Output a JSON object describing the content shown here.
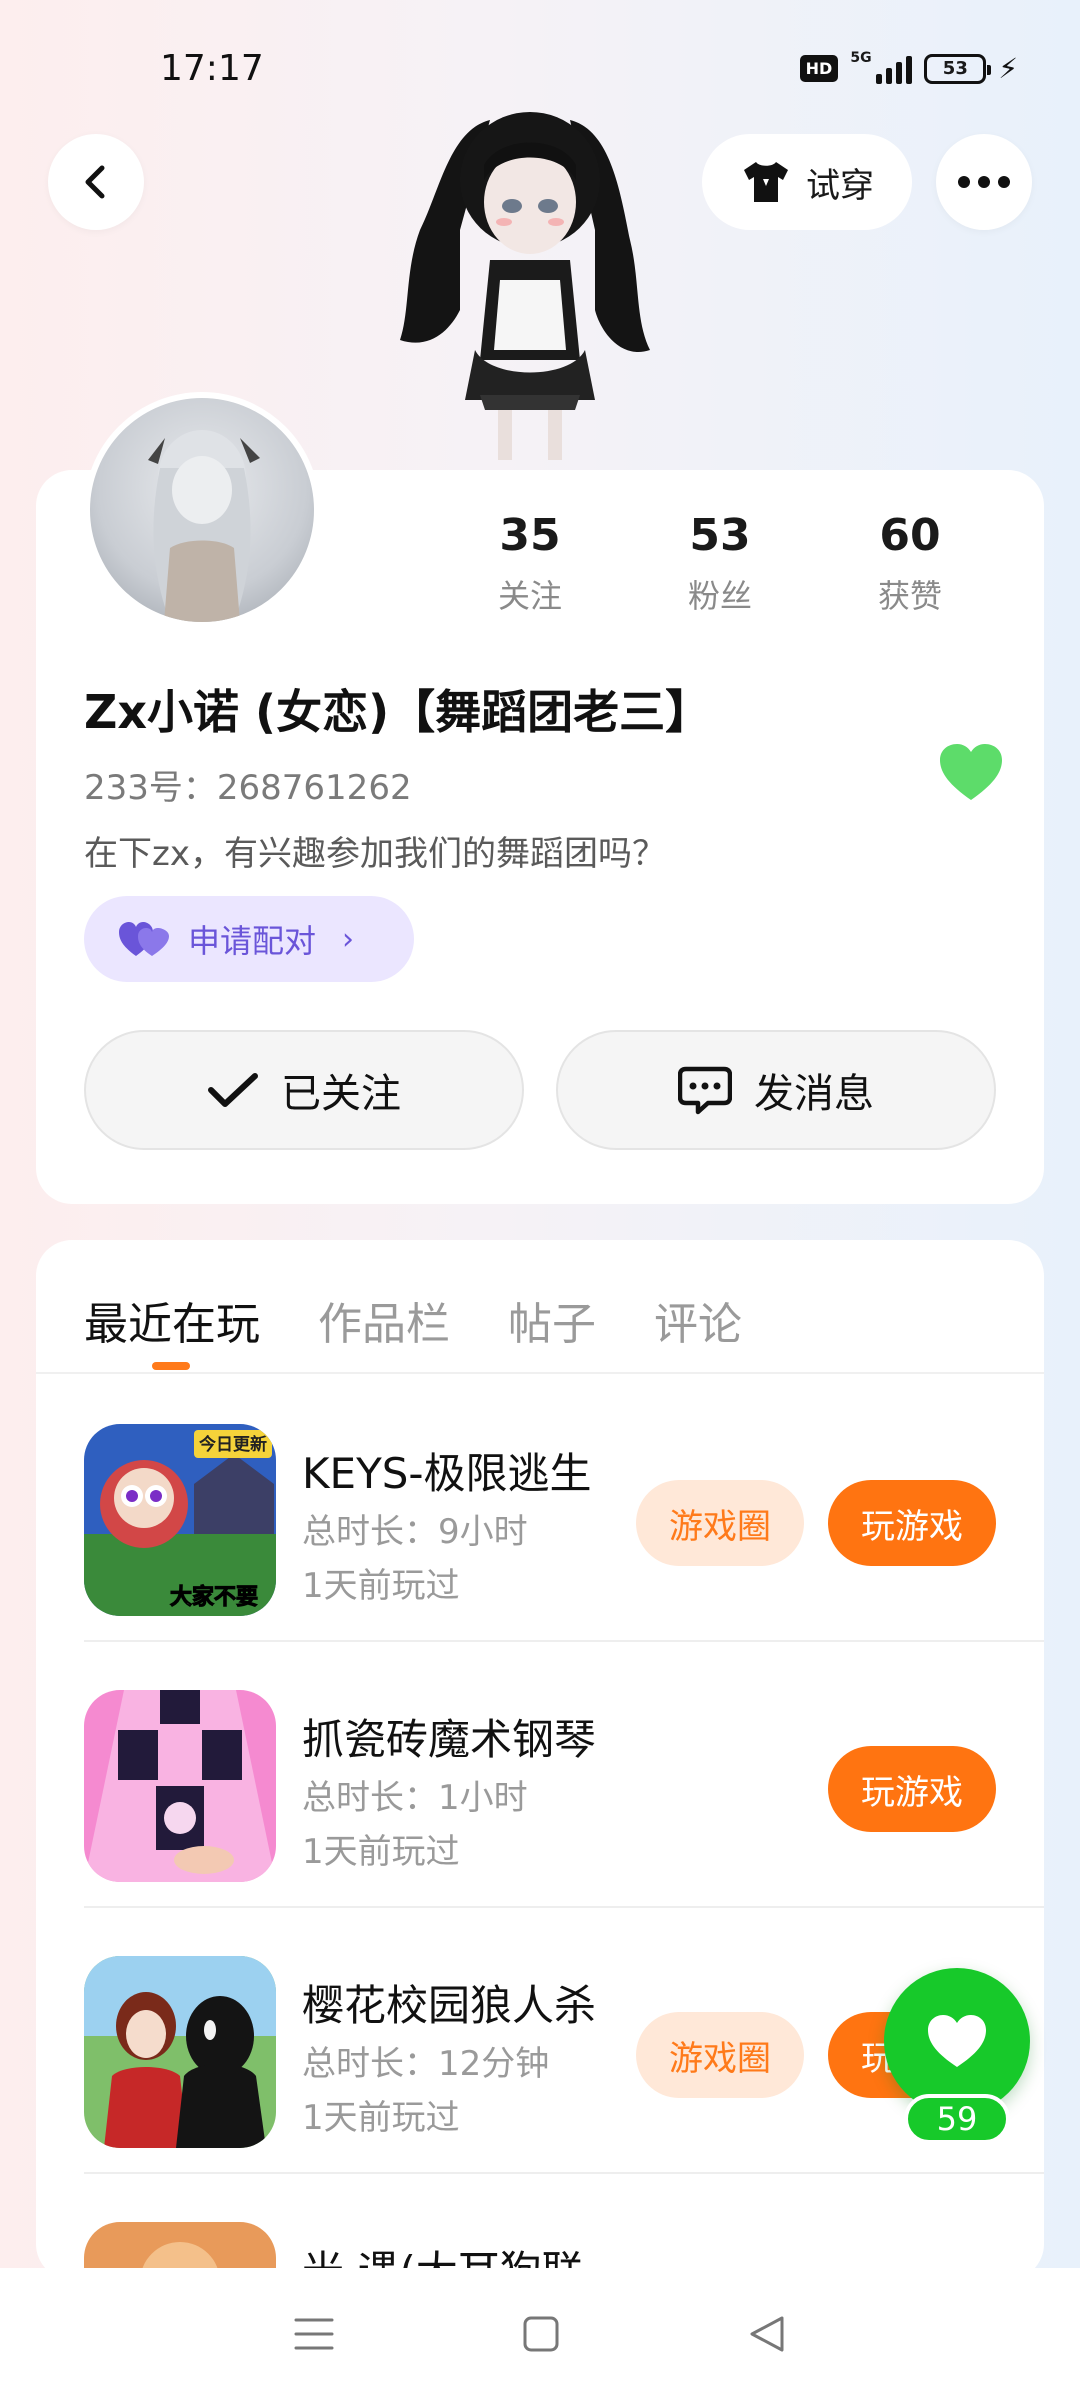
{
  "status_bar": {
    "time": "17:17",
    "hd": "HD",
    "network": "5G",
    "battery": "53"
  },
  "header": {
    "tryon_label": "试穿"
  },
  "profile": {
    "stats": [
      {
        "value": "35",
        "label": "关注"
      },
      {
        "value": "53",
        "label": "粉丝"
      },
      {
        "value": "60",
        "label": "获赞"
      }
    ],
    "nickname": "Zx小诺 (女恋)【舞蹈团老三】",
    "uid": "233号：268761262",
    "bio": "在下zx，有兴趣参加我们的舞蹈团吗？",
    "pair_label": "申请配对",
    "followed_label": "已关注",
    "message_label": "发消息",
    "accent_green": "#5ddc6a",
    "accent_orange": "#ff7411"
  },
  "tabs": [
    {
      "label": "最近在玩",
      "active": true
    },
    {
      "label": "作品栏",
      "active": false
    },
    {
      "label": "帖子",
      "active": false
    },
    {
      "label": "评论",
      "active": false
    }
  ],
  "games": [
    {
      "title": "KEYS-极限逃生",
      "duration": "总时长：9小时",
      "last_played": "1天前玩过",
      "circle_label": "游戏圈",
      "play_label": "玩游戏"
    },
    {
      "title": "抓瓷砖魔术钢琴",
      "duration": "总时长：1小时",
      "last_played": "1天前玩过",
      "play_label": "玩游戏"
    },
    {
      "title": "樱花校园狼人杀",
      "duration": "总时长：12分钟",
      "last_played": "1天前玩过",
      "circle_label": "游戏圈",
      "play_label": "玩游戏"
    },
    {
      "title": "光·遇(大耳狗联",
      "duration": "",
      "last_played": ""
    }
  ],
  "game_icon_texts": {
    "keys_badge": "今日更新",
    "keys_caption": "大家不要"
  },
  "like_fab": {
    "count": "59"
  }
}
